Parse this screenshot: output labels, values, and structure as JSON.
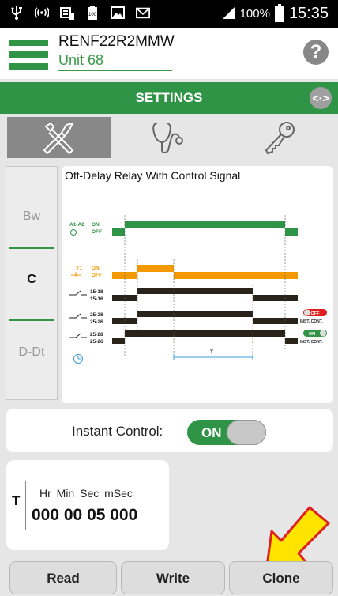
{
  "status_bar": {
    "icons": [
      "usb-icon",
      "wifi-tether-icon",
      "keyboard-icon",
      "battery-full-icon",
      "image-icon",
      "gmail-icon"
    ],
    "signal_icon": "signal-icon",
    "battery_percent": "100%",
    "time": "15:35"
  },
  "header": {
    "device_name": "RENF22R2MMW",
    "unit_name": "Unit 68",
    "help_label": "?"
  },
  "settings_bar": {
    "title": "SETTINGS",
    "sync_icon": "<·>"
  },
  "tabs": [
    {
      "name": "tools",
      "icon": "tools-icon",
      "active": true
    },
    {
      "name": "diagnostics",
      "icon": "stethoscope-icon",
      "active": false
    },
    {
      "name": "security",
      "icon": "key-icon",
      "active": false
    }
  ],
  "side_menu": {
    "items": [
      {
        "label": "Bw",
        "active": false
      },
      {
        "label": "C",
        "active": true
      },
      {
        "label": "D-Dt",
        "active": false
      }
    ]
  },
  "diagram": {
    "title": "Off-Delay Relay With Control Signal",
    "rows": {
      "a1a2": "A1-A2",
      "on": "ON",
      "off": "OFF",
      "y1": "Y1",
      "c1518": "15-18",
      "c1516": "15-16",
      "c2528": "25-28",
      "c2526": "25-26",
      "inst_cont": "INST. CONT.",
      "badge_off": "OFF",
      "badge_on": "ON",
      "t_label": "T"
    },
    "colors": {
      "a1a2": "#2f9446",
      "y1": "#f29a00",
      "contacts": "#2a2319",
      "timer": "#3ba0e0",
      "badge_off": "#e02020",
      "badge_on": "#2f9446"
    }
  },
  "instant_control": {
    "label": "Instant Control:",
    "value": "ON",
    "enabled": true
  },
  "timer": {
    "label": "T",
    "units": "Hr   Min  Sec mSec",
    "value": "000 00 05 000"
  },
  "buttons": {
    "read": "Read",
    "write": "Write",
    "clone": "Clone"
  },
  "accent_colors": {
    "brand_green": "#2f9446",
    "pointer_arrow": "#ffe400"
  }
}
